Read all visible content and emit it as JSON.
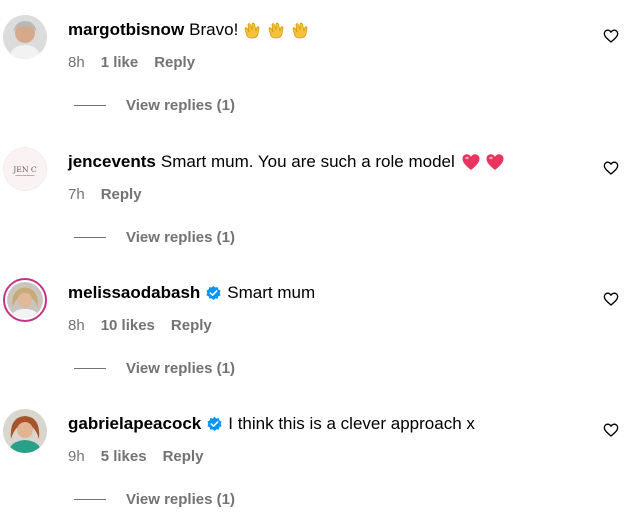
{
  "comments": [
    {
      "username": "margotbisnow",
      "verified": false,
      "text": "Bravo!",
      "emoji": [
        "clapping-hands",
        "clapping-hands",
        "clapping-hands"
      ],
      "time": "8h",
      "likes": "1 like",
      "reply": "Reply",
      "view_replies": "View replies (1)"
    },
    {
      "username": "jencevents",
      "verified": false,
      "text": "Smart mum. You are such a role model",
      "emoji": [
        "heart",
        "heart"
      ],
      "time": "7h",
      "likes": "",
      "reply": "Reply",
      "view_replies": "View replies (1)",
      "avatar_logo_text": "JEN C"
    },
    {
      "username": "melissaodabash",
      "verified": true,
      "text": "Smart mum",
      "emoji": [],
      "time": "8h",
      "likes": "10 likes",
      "reply": "Reply",
      "view_replies": "View replies (1)"
    },
    {
      "username": "gabrielapeacock",
      "verified": true,
      "text": "I think this is a clever approach x",
      "emoji": [],
      "time": "9h",
      "likes": "5 likes",
      "reply": "Reply",
      "view_replies": "View replies (1)"
    }
  ],
  "colors": {
    "text": "#000000",
    "secondary": "#737373",
    "verified": "#0095f6",
    "emoji_heart": "#e8345e"
  }
}
